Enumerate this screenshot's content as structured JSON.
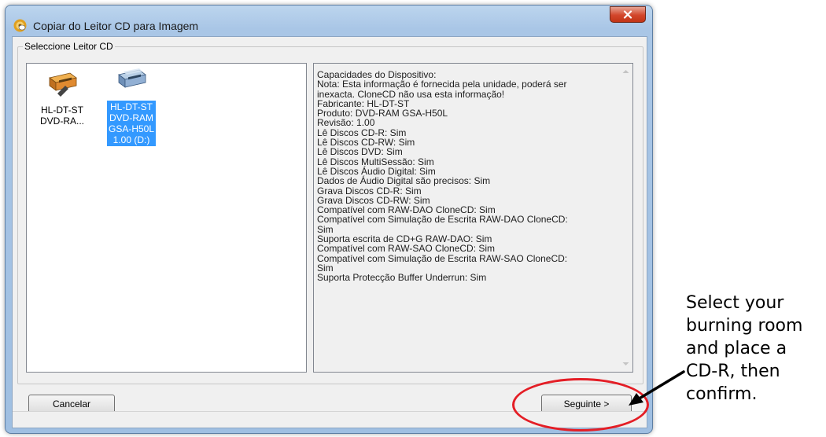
{
  "window": {
    "title": "Copiar do Leitor CD para Imagem",
    "app_icon": "clonecd-sheep-icon",
    "close_icon": "close-icon"
  },
  "group": {
    "label": "Seleccione Leitor CD"
  },
  "devices": [
    {
      "icon": "dvd-drive-icon",
      "label_line1": "HL-DT-ST",
      "label_line2": "DVD-RA...",
      "selected": false
    },
    {
      "icon": "dvd-drive-icon",
      "label_line1": "HL-DT-ST",
      "label_line2": "DVD-RAM",
      "label_line3": "GSA-H50L",
      "label_line4": "1.00 (D:)",
      "selected": true
    }
  ],
  "info": {
    "lines": [
      "Capacidades do Dispositivo:",
      "Nota: Esta informação é fornecida pela unidade, poderá ser",
      "inexacta. CloneCD não usa esta informação!",
      "Fabricante: HL-DT-ST",
      "Produto: DVD-RAM GSA-H50L",
      "Revisão: 1.00",
      "Lê Discos CD-R: Sim",
      "Lê Discos CD-RW: Sim",
      "Lê Discos DVD: Sim",
      "Lê Discos MultiSessão: Sim",
      "Lê Discos Áudio Digital: Sim",
      "Dados de Áudio Digital são precisos: Sim",
      "Grava Discos CD-R: Sim",
      "Grava Discos CD-RW: Sim",
      "Compatível com RAW-DAO CloneCD: Sim",
      "Compatível com Simulação de Escrita RAW-DAO CloneCD:",
      "Sim",
      "Suporta escrita de CD+G RAW-DAO: Sim",
      "Compatível com RAW-SAO CloneCD: Sim",
      "Compatível com Simulação de Escrita RAW-SAO CloneCD:",
      "Sim",
      "Suporta Protecção Buffer Underrun: Sim"
    ]
  },
  "buttons": {
    "cancel_label": "Cancelar",
    "next_label": "Seguinte >"
  },
  "annotation": {
    "text": "Select your burning room and place a CD-R, then confirm.",
    "color": "#e41e26"
  },
  "colors": {
    "selection": "#3399ff",
    "close_button": "#d2462b"
  }
}
